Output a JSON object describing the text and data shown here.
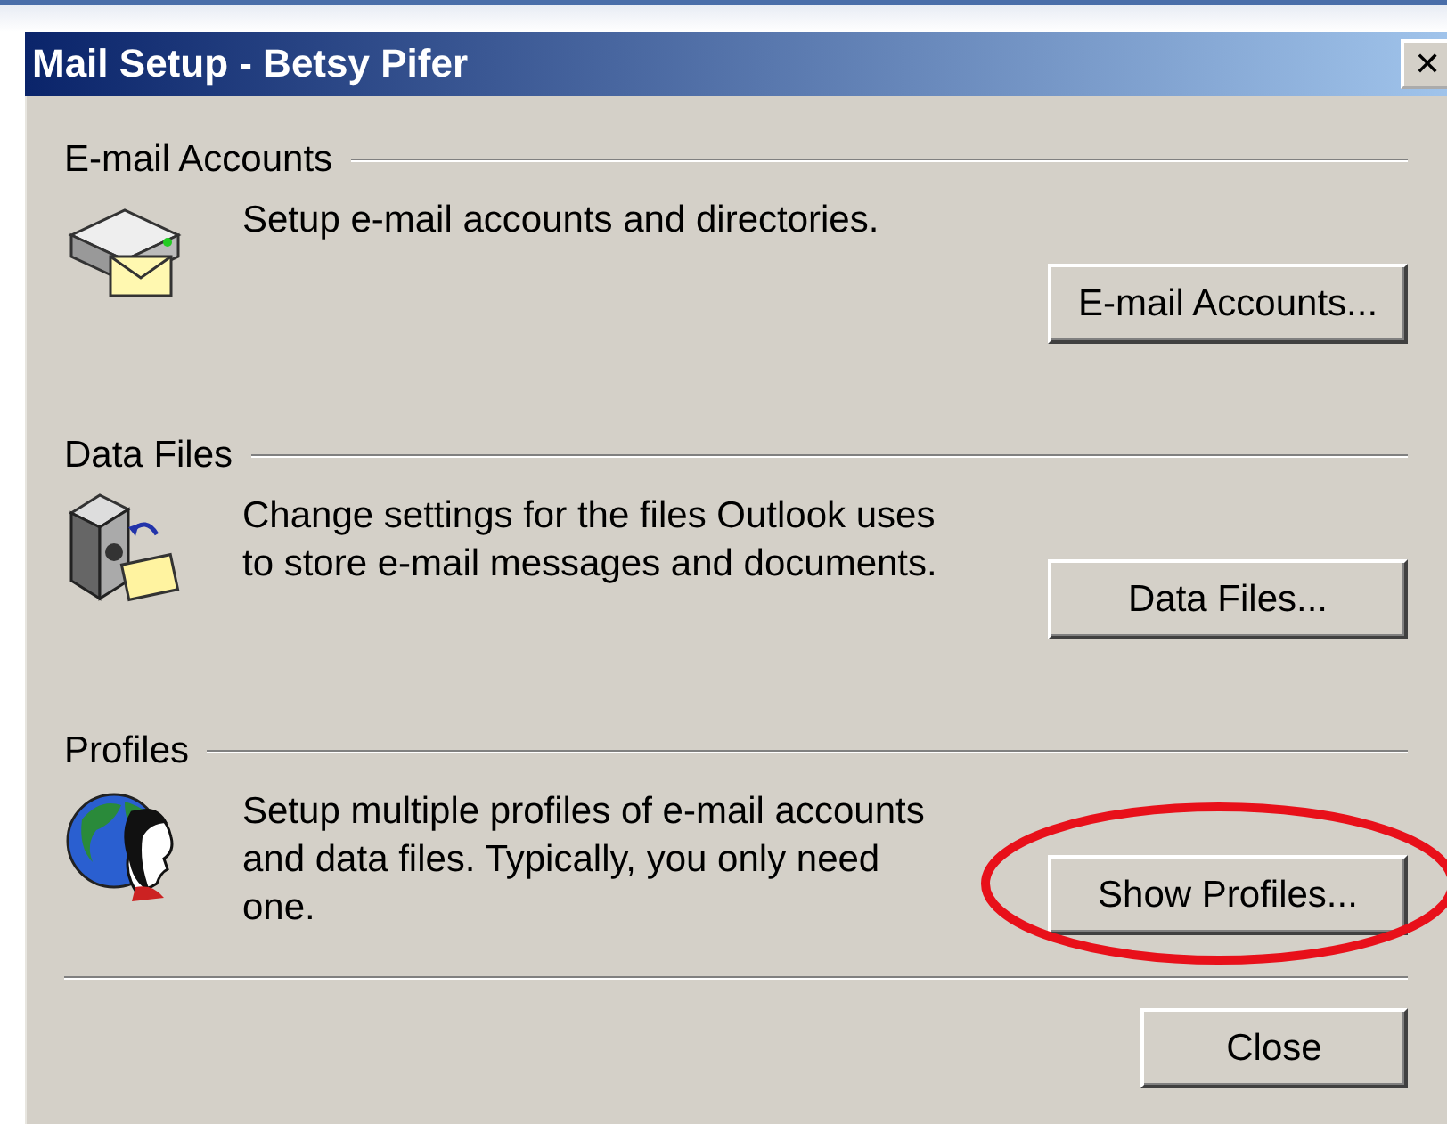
{
  "window": {
    "title": "Mail Setup - Betsy Pifer",
    "close_glyph": "✕"
  },
  "sections": [
    {
      "heading": "E-mail Accounts",
      "kind": "server",
      "description": "Setup e-mail accounts and directories.",
      "button": {
        "label": "E-mail Accounts...",
        "highlighted": false
      }
    },
    {
      "heading": "Data Files",
      "kind": "cabinet",
      "description": "Change settings for the files Outlook uses to store e-mail messages and documents.",
      "button": {
        "label": "Data Files...",
        "highlighted": false
      }
    },
    {
      "heading": "Profiles",
      "kind": "globe",
      "description": "Setup multiple profiles of e-mail accounts and data files. Typically, you only need one.",
      "button": {
        "label": "Show Profiles...",
        "highlighted": true
      }
    }
  ],
  "buttons": [
    "Close"
  ]
}
